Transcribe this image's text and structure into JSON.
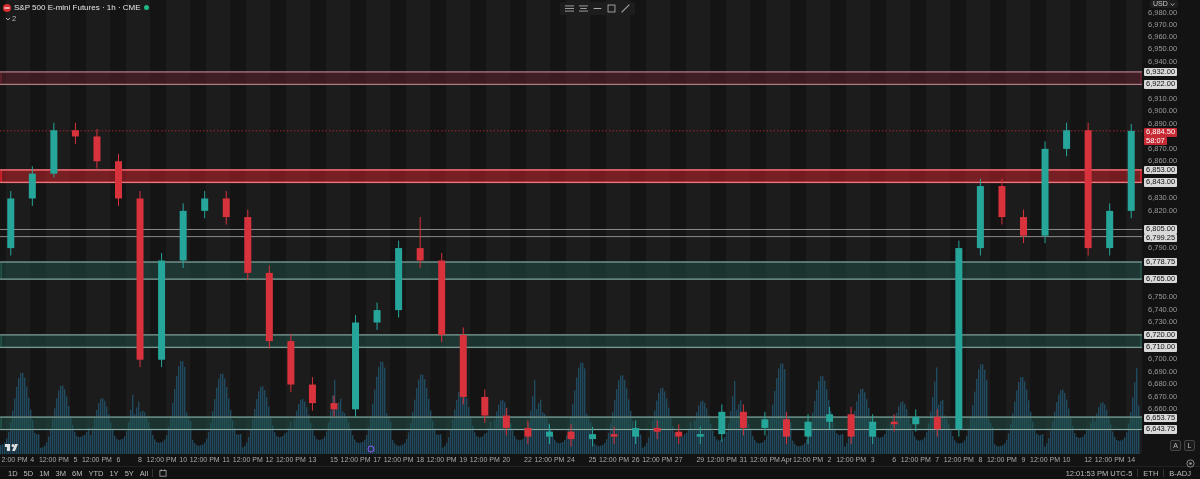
{
  "header": {
    "title": "S&P 500 E-mini Futures · 1h · CME",
    "indicator_count": "2"
  },
  "currency": "USD",
  "chart": {
    "countdown": "58:07",
    "chart_data": {
      "type": "candlestick",
      "ylim": [
        6624,
        6990
      ],
      "categories": [
        "2:00 PM",
        "4",
        "12:00 PM",
        "5",
        "12:00 PM",
        "6",
        "8",
        "12:00 PM",
        "10",
        "12:00 PM",
        "11",
        "12:00 PM",
        "12",
        "12:00 PM",
        "13",
        "15",
        "12:00 PM",
        "17",
        "12:00 PM",
        "18",
        "12:00 PM",
        "19",
        "12:00 PM",
        "20",
        "22",
        "12:00 PM",
        "24",
        "25",
        "12:00 PM",
        "26",
        "12:00 PM",
        "27",
        "29",
        "12:00 PM",
        "31",
        "12:00 PM",
        "Apr",
        "12:00 PM",
        "2",
        "12:00 PM",
        "3",
        "6",
        "12:00 PM",
        "7",
        "12:00 PM",
        "8",
        "12:00 PM",
        "9",
        "12:00 PM",
        "10",
        "12",
        "12:00 PM",
        "14"
      ],
      "ohlc": [
        [
          6790,
          6836,
          6784,
          6830
        ],
        [
          6830,
          6856,
          6824,
          6850
        ],
        [
          6850,
          6891,
          6847,
          6885
        ],
        [
          6885,
          6891,
          6874,
          6880
        ],
        [
          6880,
          6886,
          6854,
          6860
        ],
        [
          6860,
          6866,
          6824,
          6830
        ],
        [
          6830,
          6836,
          6694,
          6700
        ],
        [
          6700,
          6786,
          6694,
          6780
        ],
        [
          6780,
          6826,
          6774,
          6820
        ],
        [
          6820,
          6836,
          6814,
          6830
        ],
        [
          6830,
          6836,
          6809,
          6815
        ],
        [
          6815,
          6821,
          6764,
          6770
        ],
        [
          6770,
          6776,
          6709,
          6715
        ],
        [
          6715,
          6721,
          6674,
          6680
        ],
        [
          6680,
          6686,
          6659,
          6665
        ],
        [
          6665,
          6671,
          6654,
          6660
        ],
        [
          6660,
          6736,
          6654,
          6730
        ],
        [
          6730,
          6746,
          6724,
          6740
        ],
        [
          6740,
          6796,
          6734,
          6790
        ],
        [
          6790,
          6815,
          6774,
          6780
        ],
        [
          6780,
          6786,
          6714,
          6720
        ],
        [
          6720,
          6726,
          6664,
          6670
        ],
        [
          6670,
          6676,
          6649,
          6655
        ],
        [
          6655,
          6661,
          6639,
          6645
        ],
        [
          6645,
          6651,
          6632,
          6638
        ],
        [
          6638,
          6648,
          6632,
          6642
        ],
        [
          6642,
          6648,
          6630,
          6636
        ],
        [
          6636,
          6646,
          6630,
          6640
        ],
        [
          6640,
          6646,
          6632,
          6638
        ],
        [
          6638,
          6651,
          6632,
          6645
        ],
        [
          6645,
          6651,
          6636,
          6642
        ],
        [
          6642,
          6648,
          6632,
          6638
        ],
        [
          6638,
          6646,
          6632,
          6640
        ],
        [
          6640,
          6664,
          6634,
          6658
        ],
        [
          6658,
          6664,
          6639,
          6645
        ],
        [
          6645,
          6658,
          6639,
          6652
        ],
        [
          6652,
          6658,
          6632,
          6638
        ],
        [
          6638,
          6656,
          6632,
          6650
        ],
        [
          6650,
          6662,
          6644,
          6656
        ],
        [
          6656,
          6662,
          6632,
          6638
        ],
        [
          6638,
          6656,
          6632,
          6650
        ],
        [
          6650,
          6656,
          6642,
          6648
        ],
        [
          6648,
          6660,
          6642,
          6654
        ],
        [
          6654,
          6660,
          6638,
          6644
        ],
        [
          6644,
          6796,
          6638,
          6790
        ],
        [
          6790,
          6846,
          6784,
          6840
        ],
        [
          6840,
          6846,
          6809,
          6815
        ],
        [
          6815,
          6821,
          6794,
          6800
        ],
        [
          6800,
          6876,
          6794,
          6870
        ],
        [
          6870,
          6891,
          6864,
          6885
        ],
        [
          6885,
          6891,
          6784,
          6790
        ],
        [
          6790,
          6826,
          6784,
          6820
        ],
        [
          6820,
          6890,
          6814,
          6884.5
        ]
      ],
      "yticks": [
        {
          "value": 6980,
          "label": "6,980.00"
        },
        {
          "value": 6970,
          "label": "6,970.00"
        },
        {
          "value": 6960,
          "label": "6,960.00"
        },
        {
          "value": 6950,
          "label": "6,950.00"
        },
        {
          "value": 6940,
          "label": "6,940.00"
        },
        {
          "value": 6910,
          "label": "6,910.00"
        },
        {
          "value": 6900,
          "label": "6,900.00"
        },
        {
          "value": 6890,
          "label": "6,890.00"
        },
        {
          "value": 6870,
          "label": "6,870.00"
        },
        {
          "value": 6860,
          "label": "6,860.00"
        },
        {
          "value": 6830,
          "label": "6,830.00"
        },
        {
          "value": 6820,
          "label": "6,820.00"
        },
        {
          "value": 6790,
          "label": "6,790.00"
        },
        {
          "value": 6750,
          "label": "6,750.00"
        },
        {
          "value": 6740,
          "label": "6,740.00"
        },
        {
          "value": 6730,
          "label": "6,730.00"
        },
        {
          "value": 6700,
          "label": "6,700.00"
        },
        {
          "value": 6690,
          "label": "6,690.00"
        },
        {
          "value": 6680,
          "label": "6,680.00"
        },
        {
          "value": 6670,
          "label": "6,670.00"
        },
        {
          "value": 6660,
          "label": "6,660.00"
        }
      ],
      "bands": [
        {
          "axis": "y",
          "from": 6922,
          "to": 6932,
          "color": "#6a2430"
        },
        {
          "axis": "y",
          "from": 6843,
          "to": 6853,
          "color": "#e8232f"
        },
        {
          "axis": "y",
          "from": 6765,
          "to": 6778.75,
          "color": "#23584d"
        },
        {
          "axis": "y",
          "from": 6710,
          "to": 6720,
          "color": "#23584d"
        },
        {
          "axis": "y",
          "from": 6643.75,
          "to": 6653.75,
          "color": "#23584d"
        }
      ],
      "ref_lines": [
        {
          "axis": "y",
          "value": 6932,
          "label": "6,932.00",
          "color": "#d9d9d9"
        },
        {
          "axis": "y",
          "value": 6922,
          "label": "6,922.00",
          "color": "#d9d9d9"
        },
        {
          "axis": "y",
          "value": 6884.5,
          "label": "6,884.50",
          "color": "#c62a33"
        },
        {
          "axis": "y",
          "value": 6853,
          "label": "6,853.00",
          "color": "#d9d9d9"
        },
        {
          "axis": "y",
          "value": 6843,
          "label": "6,843.00",
          "color": "#d9d9d9"
        },
        {
          "axis": "y",
          "value": 6805,
          "label": "6,805.00",
          "color": "#d9d9d9"
        },
        {
          "axis": "y",
          "value": 6799.25,
          "label": "6,799.25",
          "color": "#d9d9d9"
        },
        {
          "axis": "y",
          "value": 6778.75,
          "label": "6,778.75",
          "color": "#d9d9d9"
        },
        {
          "axis": "y",
          "value": 6765,
          "label": "6,765.00",
          "color": "#d9d9d9"
        },
        {
          "axis": "y",
          "value": 6720,
          "label": "6,720.00",
          "color": "#d9d9d9"
        },
        {
          "axis": "y",
          "value": 6710,
          "label": "6,710.00",
          "color": "#d9d9d9"
        },
        {
          "axis": "y",
          "value": 6653.75,
          "label": "6,653.75",
          "color": "#d9d9d9"
        },
        {
          "axis": "y",
          "value": 6643.75,
          "label": "6,643.75",
          "color": "#d9d9d9"
        }
      ]
    }
  },
  "axis_buttons": [
    "A",
    "L"
  ],
  "ranges": [
    "1D",
    "5D",
    "1M",
    "3M",
    "6M",
    "YTD",
    "1Y",
    "5Y",
    "All"
  ],
  "status": {
    "time": "12:01:53 PM UTC-5",
    "session": "ETH",
    "adjustment": "B-ADJ"
  }
}
